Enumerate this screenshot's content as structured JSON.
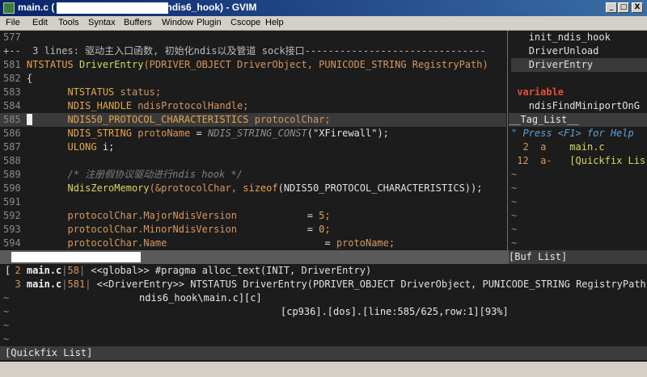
{
  "window": {
    "title_prefix": "main.c (",
    "title_suffix": "ndis6_hook) - GVIM",
    "btn_min": "_",
    "btn_max": "□",
    "btn_close": "X"
  },
  "menu": [
    "File",
    "Edit",
    "Tools",
    "Syntax",
    "Buffers",
    "Window",
    "Plugin",
    "Cscope",
    "Help"
  ],
  "code": {
    "l577": "577",
    "l578_fold": "+--  3 lines: 驱动主入口函数, 初始化ndis以及管道 sock接口-------------------------------",
    "l581": "581",
    "l581_t1": "NTSTATUS",
    "l581_t2": "DriverEntry",
    "l581_t3": "(PDRIVER_OBJECT DriverObject, PUNICODE_STRING RegistryPath)",
    "l582": "582",
    "l582_t": "{",
    "l583": "583",
    "l583_t1": "NTSTATUS",
    "l583_t2": "status;",
    "l584": "584",
    "l584_t1": "NDIS_HANDLE",
    "l584_t2": "ndisProtocolHandle;",
    "l585": "585",
    "l585_t1": "NDIS50_PROTOCOL_CHARACTERISTICS",
    "l585_t2": "protocolChar;",
    "l586": "586",
    "l586_t1": "NDIS_STRING",
    "l586_t2": "protoName",
    "l586_t3": "=",
    "l586_t4": "NDIS_STRING_CONST",
    "l586_t5": "(\"XFirewall\");",
    "l587": "587",
    "l587_t1": "ULONG",
    "l587_t2": "i;",
    "l588": "588",
    "l589": "589",
    "l589_t": "/* 注册假协议驱动进行ndis hook */",
    "l590": "590",
    "l590_t1": "NdisZeroMemory",
    "l590_t2": "(&protocolChar,",
    "l590_t3": "sizeof",
    "l590_t4": "(NDIS50_PROTOCOL_CHARACTERISTICS));",
    "l591": "591",
    "l592": "592",
    "l592_t1": "protocolChar.MajorNdisVersion",
    "l592_t2": "=",
    "l592_t3": "5;",
    "l593": "593",
    "l593_t1": "protocolChar.MinorNdisVersion",
    "l593_t2": "=",
    "l593_t3": "0;",
    "l594": "594",
    "l594_t1": "protocolChar.Name",
    "l594_t2": "=",
    "l594_t3": "protoName;"
  },
  "taglist": {
    "items": [
      "init_ndis_hook",
      "DriverUnload",
      "DriverEntry"
    ],
    "section": "variable",
    "var_item": "ndisFindMiniportOnG",
    "title": "__Tag_List__"
  },
  "buflist": {
    "help": "\" Press <F1> for Help",
    "rows": [
      {
        "num": "2",
        "flag": "a",
        "name": "main.c"
      },
      {
        "num": "12",
        "flag": "a-",
        "name": "[Quickfix Lis"
      }
    ]
  },
  "status_main": {
    "path": "ndis6_hook\\main.c][c]",
    "info": "[cp936].[dos].[line:585/625,row:1][93%]"
  },
  "status_buf": "[Buf List]",
  "quickfix": {
    "rows": [
      {
        "num": "2",
        "file": "main.c",
        "line": "58",
        "text": "<<global>> #pragma alloc_text(INIT, DriverEntry)"
      },
      {
        "num": "3",
        "file": "main.c",
        "line": "581",
        "text": "<<DriverEntry>> NTSTATUS DriverEntry(PDRIVER_OBJECT DriverObject, PUNICODE_STRING RegistryPath)"
      }
    ],
    "status": "[Quickfix List]"
  },
  "tilde": "~"
}
